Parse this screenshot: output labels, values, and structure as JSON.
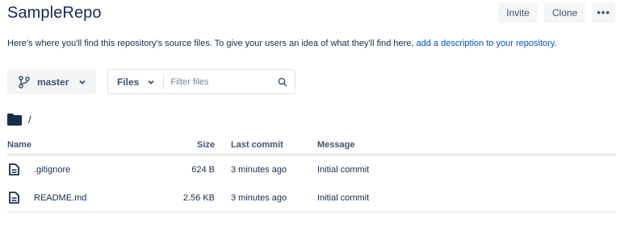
{
  "repo": {
    "title": "SampleRepo"
  },
  "actions": {
    "invite": "Invite",
    "clone": "Clone",
    "more": "•••"
  },
  "description": {
    "text": "Here's where you'll find this repository's source files. To give your users an idea of what they'll find here, ",
    "link": "add a description to your repository",
    "end": "."
  },
  "branch": {
    "label": "master",
    "icon": "branch-icon"
  },
  "filter": {
    "scope": "Files",
    "placeholder": "Filter files",
    "icon": "search-icon"
  },
  "path": {
    "icon": "folder-icon",
    "text": "/"
  },
  "table": {
    "headers": {
      "name": "Name",
      "size": "Size",
      "last_commit": "Last commit",
      "message": "Message"
    },
    "rows": [
      {
        "name": ".gitignore",
        "size": "624 B",
        "last_commit": "3 minutes ago",
        "message": "Initial commit",
        "icon": "file-icon"
      },
      {
        "name": "README.md",
        "size": "2.56 KB",
        "last_commit": "3 minutes ago",
        "message": "Initial commit",
        "icon": "file-icon"
      }
    ]
  },
  "colors": {
    "link": "#0052cc",
    "text": "#172b4d",
    "muted": "#42526e",
    "button_bg": "#f4f5f7",
    "border": "#dfe1e6"
  }
}
